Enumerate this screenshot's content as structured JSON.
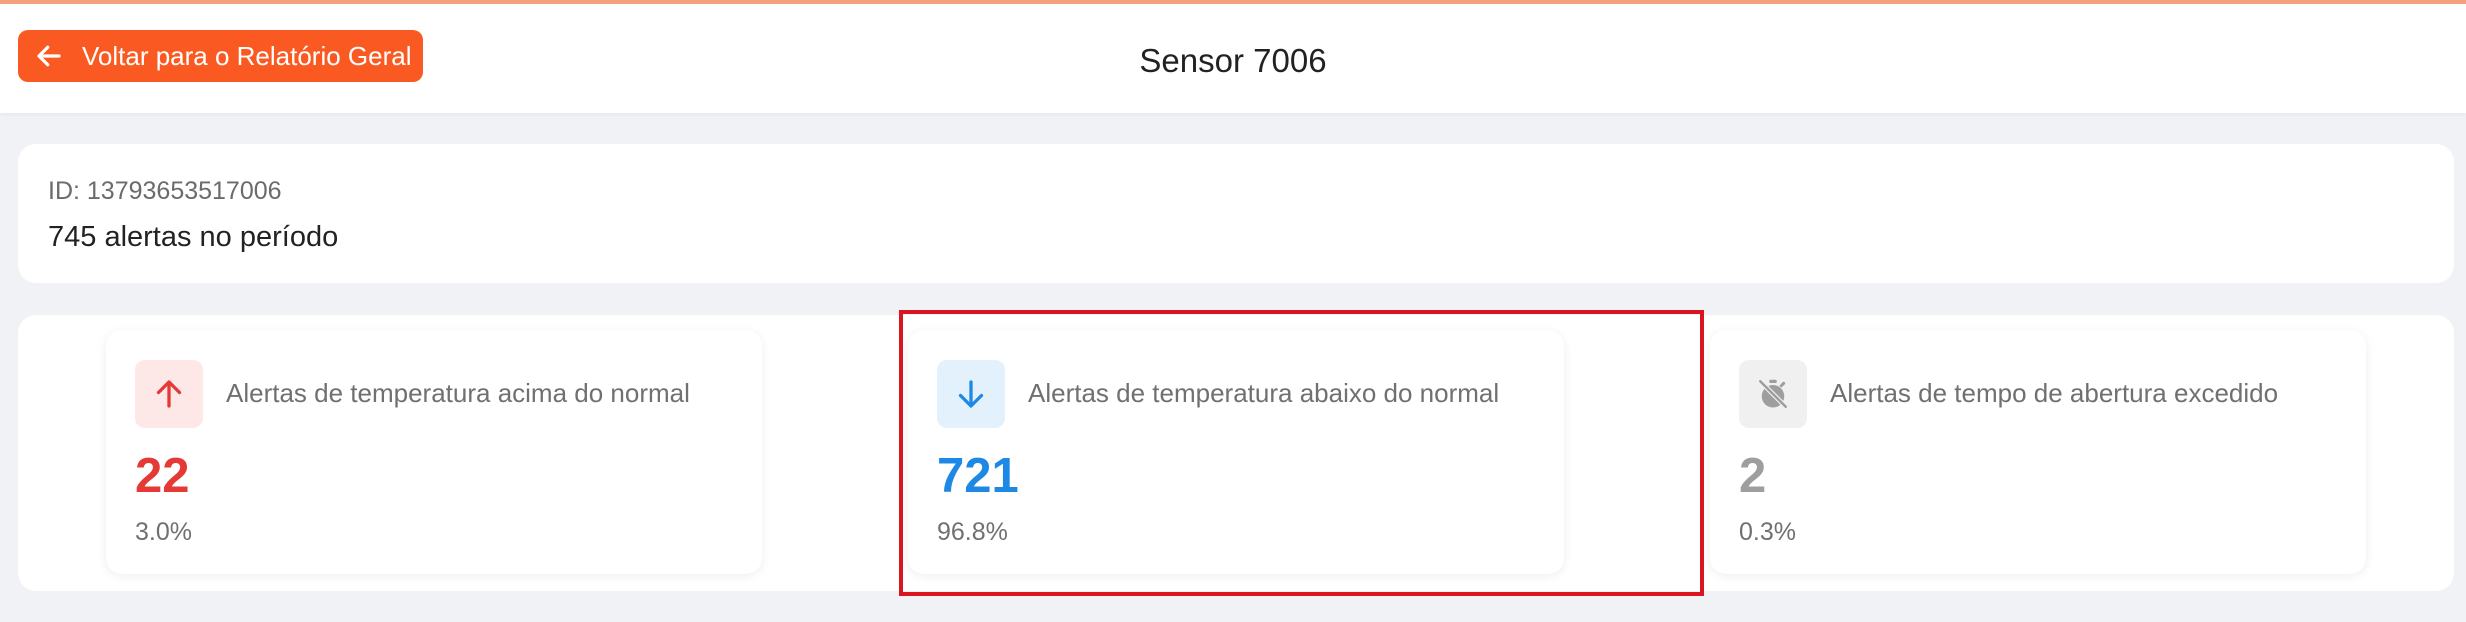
{
  "header": {
    "back_label": "Voltar para o Relatório Geral",
    "title": "Sensor 7006"
  },
  "info": {
    "id_text": "ID: 13793653517006",
    "alert_count_text": "745 alertas no período"
  },
  "stats": [
    {
      "label": "Alertas de temperatura acima do normal",
      "value": "22",
      "percent": "3.0%",
      "icon": "arrow-up-icon",
      "color": "#e53935",
      "icon_bg": "#fde7e7"
    },
    {
      "label": "Alertas de temperatura abaixo do normal",
      "value": "721",
      "percent": "96.8%",
      "icon": "arrow-down-icon",
      "color": "#1e88e5",
      "icon_bg": "#e3f1fd"
    },
    {
      "label": "Alertas de tempo de abertura excedido",
      "value": "2",
      "percent": "0.3%",
      "icon": "timer-off-icon",
      "color": "#9e9e9e",
      "icon_bg": "#f0f0f0"
    }
  ],
  "colors": {
    "brand": "#fa5a22",
    "highlight": "#d9161f"
  }
}
